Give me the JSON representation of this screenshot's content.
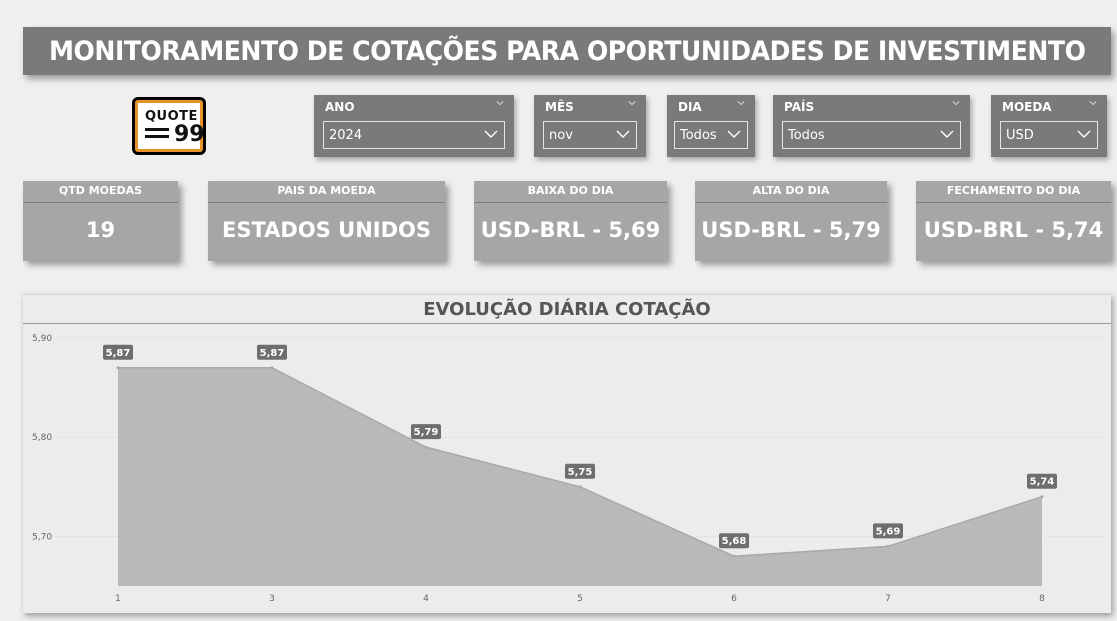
{
  "header": {
    "title": "MONITORAMENTO DE COTAÇÕES PARA OPORTUNIDADES DE INVESTIMENTO"
  },
  "logo": {
    "word": "QUOTE",
    "marks": "99",
    "icon": "quote-logo-icon"
  },
  "slicers": [
    {
      "label": "ANO",
      "value": "2024"
    },
    {
      "label": "MÊS",
      "value": "nov"
    },
    {
      "label": "DIA",
      "value": "Todos"
    },
    {
      "label": "PAÍS",
      "value": "Todos"
    },
    {
      "label": "MOEDA",
      "value": "USD"
    }
  ],
  "cards": [
    {
      "label": "QTD MOEDAS",
      "value": "19"
    },
    {
      "label": "PAIS DA MOEDA",
      "value": "ESTADOS UNIDOS"
    },
    {
      "label": "BAIXA DO DIA",
      "value": "USD-BRL - 5,69"
    },
    {
      "label": "ALTA DO DIA",
      "value": "USD-BRL - 5,79"
    },
    {
      "label": "FECHAMENTO DO DIA",
      "value": "USD-BRL - 5,74"
    }
  ],
  "colors": {
    "background": "#efefef",
    "header_bg": "#7a7a7a",
    "card_bg": "#a6a6a6",
    "area_fill": "#b9b9b9",
    "data_label_bg": "#6e6e6e",
    "logo_accent": "#e8922a"
  },
  "chart_data": {
    "type": "area",
    "title": "EVOLUÇÃO DIÁRIA COTAÇÃO",
    "x": [
      "1",
      "3",
      "4",
      "5",
      "6",
      "7",
      "8"
    ],
    "values": [
      5.87,
      5.87,
      5.79,
      5.75,
      5.68,
      5.69,
      5.74
    ],
    "data_labels": [
      "5,87",
      "5,87",
      "5,79",
      "5,75",
      "5,68",
      "5,69",
      "5,74"
    ],
    "y_ticks": [
      5.9,
      5.8,
      5.7
    ],
    "y_tick_labels": [
      "5,90",
      "5,80",
      "5,70"
    ],
    "ylim": [
      5.65,
      5.9
    ],
    "grid": true,
    "legend": "none"
  }
}
